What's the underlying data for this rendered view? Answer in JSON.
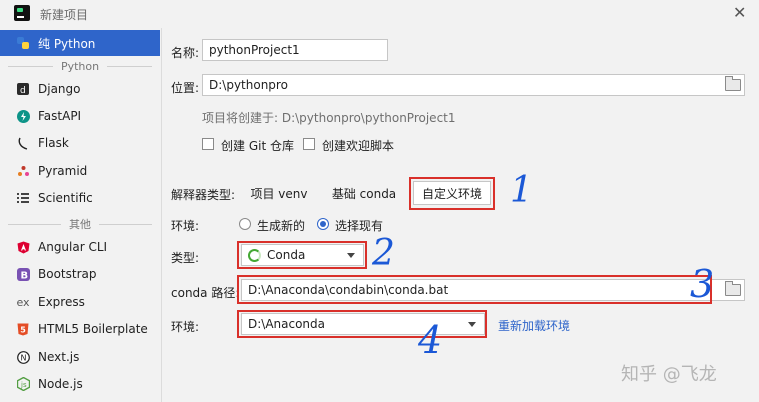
{
  "window": {
    "title": "新建项目"
  },
  "sidebar": {
    "items": [
      {
        "label": "纯 Python",
        "icon": "python-icon"
      },
      {
        "label": "Django",
        "icon": "django-icon"
      },
      {
        "label": "FastAPI",
        "icon": "fastapi-icon"
      },
      {
        "label": "Flask",
        "icon": "flask-icon"
      },
      {
        "label": "Pyramid",
        "icon": "pyramid-icon"
      },
      {
        "label": "Scientific",
        "icon": "scientific-icon"
      },
      {
        "label": "Angular CLI",
        "icon": "angular-icon"
      },
      {
        "label": "Bootstrap",
        "icon": "bootstrap-icon"
      },
      {
        "label": "Express",
        "icon": "express-icon"
      },
      {
        "label": "HTML5 Boilerplate",
        "icon": "html5-icon"
      },
      {
        "label": "Next.js",
        "icon": "nextjs-icon"
      },
      {
        "label": "Node.js",
        "icon": "nodejs-icon"
      }
    ],
    "sections": {
      "python": "Python",
      "other": "其他"
    }
  },
  "form": {
    "name_label": "名称:",
    "name_value": "pythonProject1",
    "location_label": "位置:",
    "location_value": "D:\\pythonpro",
    "created_hint": "项目将创建于: D:\\pythonpro\\pythonProject1",
    "git_label": "创建 Git 仓库",
    "welcome_label": "创建欢迎脚本",
    "interpreter_type_label": "解释器类型:",
    "tabs": [
      "项目 venv",
      "基础 conda",
      "自定义环境"
    ],
    "env_label": "环境:",
    "radio_new": "生成新的",
    "radio_existing": "选择现有",
    "type_label": "类型:",
    "type_value": "Conda",
    "conda_path_label": "conda 路径:",
    "conda_path_value": "D:\\Anaconda\\condabin\\conda.bat",
    "env2_label": "环境:",
    "env2_value": "D:\\Anaconda",
    "reload_link": "重新加载环境"
  },
  "annotations": [
    "1",
    "2",
    "3",
    "4"
  ],
  "watermark": "知乎 @飞龙",
  "colors": {
    "accent": "#2f65ca",
    "highlight_box": "#d9302a",
    "annotation": "#1b58d6"
  }
}
